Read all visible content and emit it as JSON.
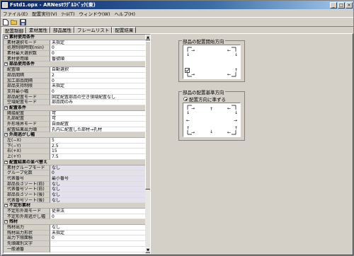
{
  "window": {
    "title": "Fstd1.opx - ARNestﾜｸﾞﾙｽﾍﾟｯｸ(東)"
  },
  "menu": [
    "ファイル(E)",
    "配置実行(V)",
    "ﾂｰﾙ(T)",
    "ウィンドウ(W)",
    "ヘルプ(H)"
  ],
  "tabs": [
    "配置制御",
    "素材属性",
    "部品属性",
    "フレームリスト",
    "配置結果"
  ],
  "properties": [
    {
      "type": "header",
      "label": "素材使用条件"
    },
    {
      "key": "素材選択モード",
      "value": "未指定"
    },
    {
      "key": "処理制限時間(min)",
      "value": "0"
    },
    {
      "key": "素材最大選択数",
      "value": "0"
    },
    {
      "key": "素材使用順",
      "value": "番號順"
    },
    {
      "type": "header",
      "label": "部品使用条件"
    },
    {
      "key": "配置順",
      "value": "自動選択"
    },
    {
      "key": "部品間隔",
      "value": "2"
    },
    {
      "key": "加工部品間隔",
      "value": "0"
    },
    {
      "key": "部品支持制限",
      "value": "未指定"
    },
    {
      "key": "支持最小幅",
      "value": "0"
    },
    {
      "key": "部品配置モード",
      "value": "固定配置部品の空き領域配置なし"
    },
    {
      "key": "空域配置モード",
      "value": "部品間のみ"
    },
    {
      "type": "header",
      "label": "配置条件"
    },
    {
      "key": "隣接配置",
      "value": "可"
    },
    {
      "key": "孔部配置",
      "value": "可"
    },
    {
      "key": "外形境界モード",
      "value": "自由配置"
    },
    {
      "key": "配置結果出力順",
      "value": "孔内に配置した部材→孔材"
    },
    {
      "type": "header",
      "label": "外周逃がし幅"
    },
    {
      "key": "左(−X)",
      "value": "5"
    },
    {
      "key": "下(−Y)",
      "value": "2.5"
    },
    {
      "key": "右(+X)",
      "value": "15"
    },
    {
      "key": "上(+Y)",
      "value": "7.5"
    },
    {
      "type": "header",
      "label": "配置結果の並べ替え"
    },
    {
      "key": "素材グループモード",
      "value": "なし",
      "alt": true
    },
    {
      "key": "グループ化数",
      "value": "0",
      "alt": true
    },
    {
      "key": "代表番号",
      "value": "最小番号",
      "alt": true
    },
    {
      "key": "部品長さソート(前)",
      "value": "なし",
      "alt": true
    },
    {
      "key": "代表番号ソート(前)",
      "value": "なし",
      "alt": true
    },
    {
      "key": "部品長さソート(後)",
      "value": "なし",
      "alt": true
    },
    {
      "key": "代表番号ソート(後)",
      "value": "なし",
      "alt": true
    },
    {
      "type": "header",
      "label": "不定形素材"
    },
    {
      "key": "不定形外周モード",
      "value": "従来法"
    },
    {
      "key": "不定形外周逃がし幅",
      "value": "0"
    },
    {
      "type": "header",
      "label": "残材"
    },
    {
      "key": "残材出力",
      "value": "なし"
    },
    {
      "key": "残材出力形状",
      "value": "未指定"
    },
    {
      "key": "出力下限面積",
      "value": "0"
    },
    {
      "key": "先頭識別文字",
      "value": ""
    },
    {
      "key": "一般通番",
      "value": ""
    }
  ],
  "start_direction": {
    "label": "部品の配置開始方向"
  },
  "reference_direction": {
    "label": "部品の配置基準方向",
    "option": "配置方向に準ずる"
  },
  "icons": [
    "new-file-icon",
    "open-folder-icon",
    "save-icon"
  ]
}
